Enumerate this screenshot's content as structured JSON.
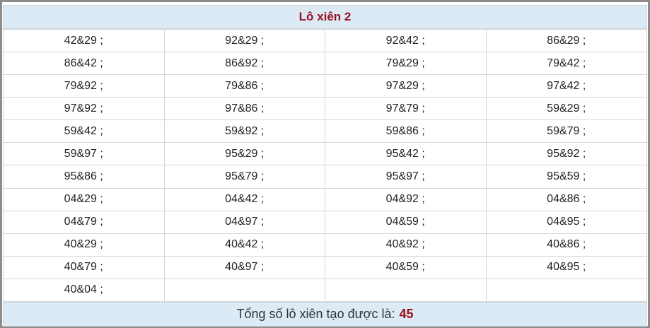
{
  "header": {
    "title": "Lô xiên 2"
  },
  "grid": {
    "rows": [
      [
        "42&29 ;",
        "92&29 ;",
        "92&42 ;",
        "86&29 ;"
      ],
      [
        "86&42 ;",
        "86&92 ;",
        "79&29 ;",
        "79&42 ;"
      ],
      [
        "79&92 ;",
        "79&86 ;",
        "97&29 ;",
        "97&42 ;"
      ],
      [
        "97&92 ;",
        "97&86 ;",
        "97&79 ;",
        "59&29 ;"
      ],
      [
        "59&42 ;",
        "59&92 ;",
        "59&86 ;",
        "59&79 ;"
      ],
      [
        "59&97 ;",
        "95&29 ;",
        "95&42 ;",
        "95&92 ;"
      ],
      [
        "95&86 ;",
        "95&79 ;",
        "95&97 ;",
        "95&59 ;"
      ],
      [
        "04&29 ;",
        "04&42 ;",
        "04&92 ;",
        "04&86 ;"
      ],
      [
        "04&79 ;",
        "04&97 ;",
        "04&59 ;",
        "04&95 ;"
      ],
      [
        "40&29 ;",
        "40&42 ;",
        "40&92 ;",
        "40&86 ;"
      ],
      [
        "40&79 ;",
        "40&97 ;",
        "40&59 ;",
        "40&95 ;"
      ],
      [
        "40&04 ;",
        "",
        "",
        ""
      ]
    ]
  },
  "footer": {
    "label": "Tổng số lô xiên tạo được là:",
    "count": "45"
  },
  "colors": {
    "accent": "#9c0e1d",
    "header_bg": "#dbeaf5",
    "frame_border": "#8c8c8c",
    "cell_border": "#d6d6d6"
  }
}
